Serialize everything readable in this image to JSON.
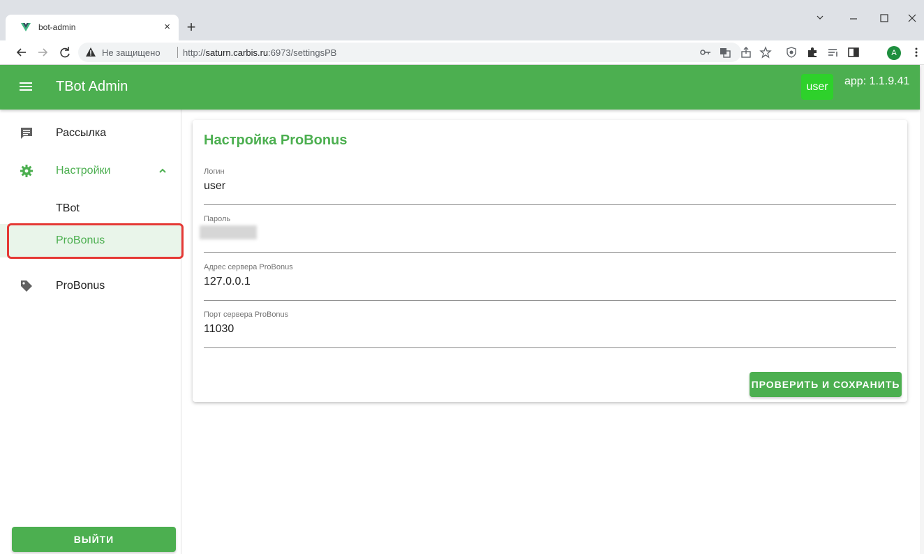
{
  "browser": {
    "tab_title": "bot-admin",
    "tab_close": "×",
    "new_tab": "+",
    "omnibox_warning": "Не защищено",
    "url_scheme": "http://",
    "url_host": "saturn.carbis.ru",
    "url_path": ":6973/settingsPB",
    "profile_initial": "A"
  },
  "appbar": {
    "title": "TBot Admin",
    "user_chip": "user",
    "version": "app: 1.1.9.41"
  },
  "sidebar": {
    "items": [
      {
        "label": "Рассылка",
        "icon": "message-text-icon"
      },
      {
        "label": "Настройки",
        "icon": "gear-icon",
        "expanded": true
      },
      {
        "label": "ProBonus",
        "icon": "tag-icon"
      }
    ],
    "sub_items": [
      {
        "label": "TBot"
      },
      {
        "label": "ProBonus",
        "selected": true
      }
    ],
    "logout": "ВЫЙТИ"
  },
  "card": {
    "title": "Настройка ProBonus",
    "fields": [
      {
        "label": "Логин",
        "value": "user"
      },
      {
        "label": "Пароль",
        "value": ""
      },
      {
        "label": "Адрес сервера ProBonus",
        "value": "127.0.0.1"
      },
      {
        "label": "Порт сервера ProBonus",
        "value": "11030"
      }
    ],
    "save_button": "ПРОВЕРИТЬ И СОХРАНИТЬ"
  },
  "colors": {
    "primary": "#4caf50",
    "user_chip": "#2ed12b",
    "highlight": "#e53935"
  }
}
